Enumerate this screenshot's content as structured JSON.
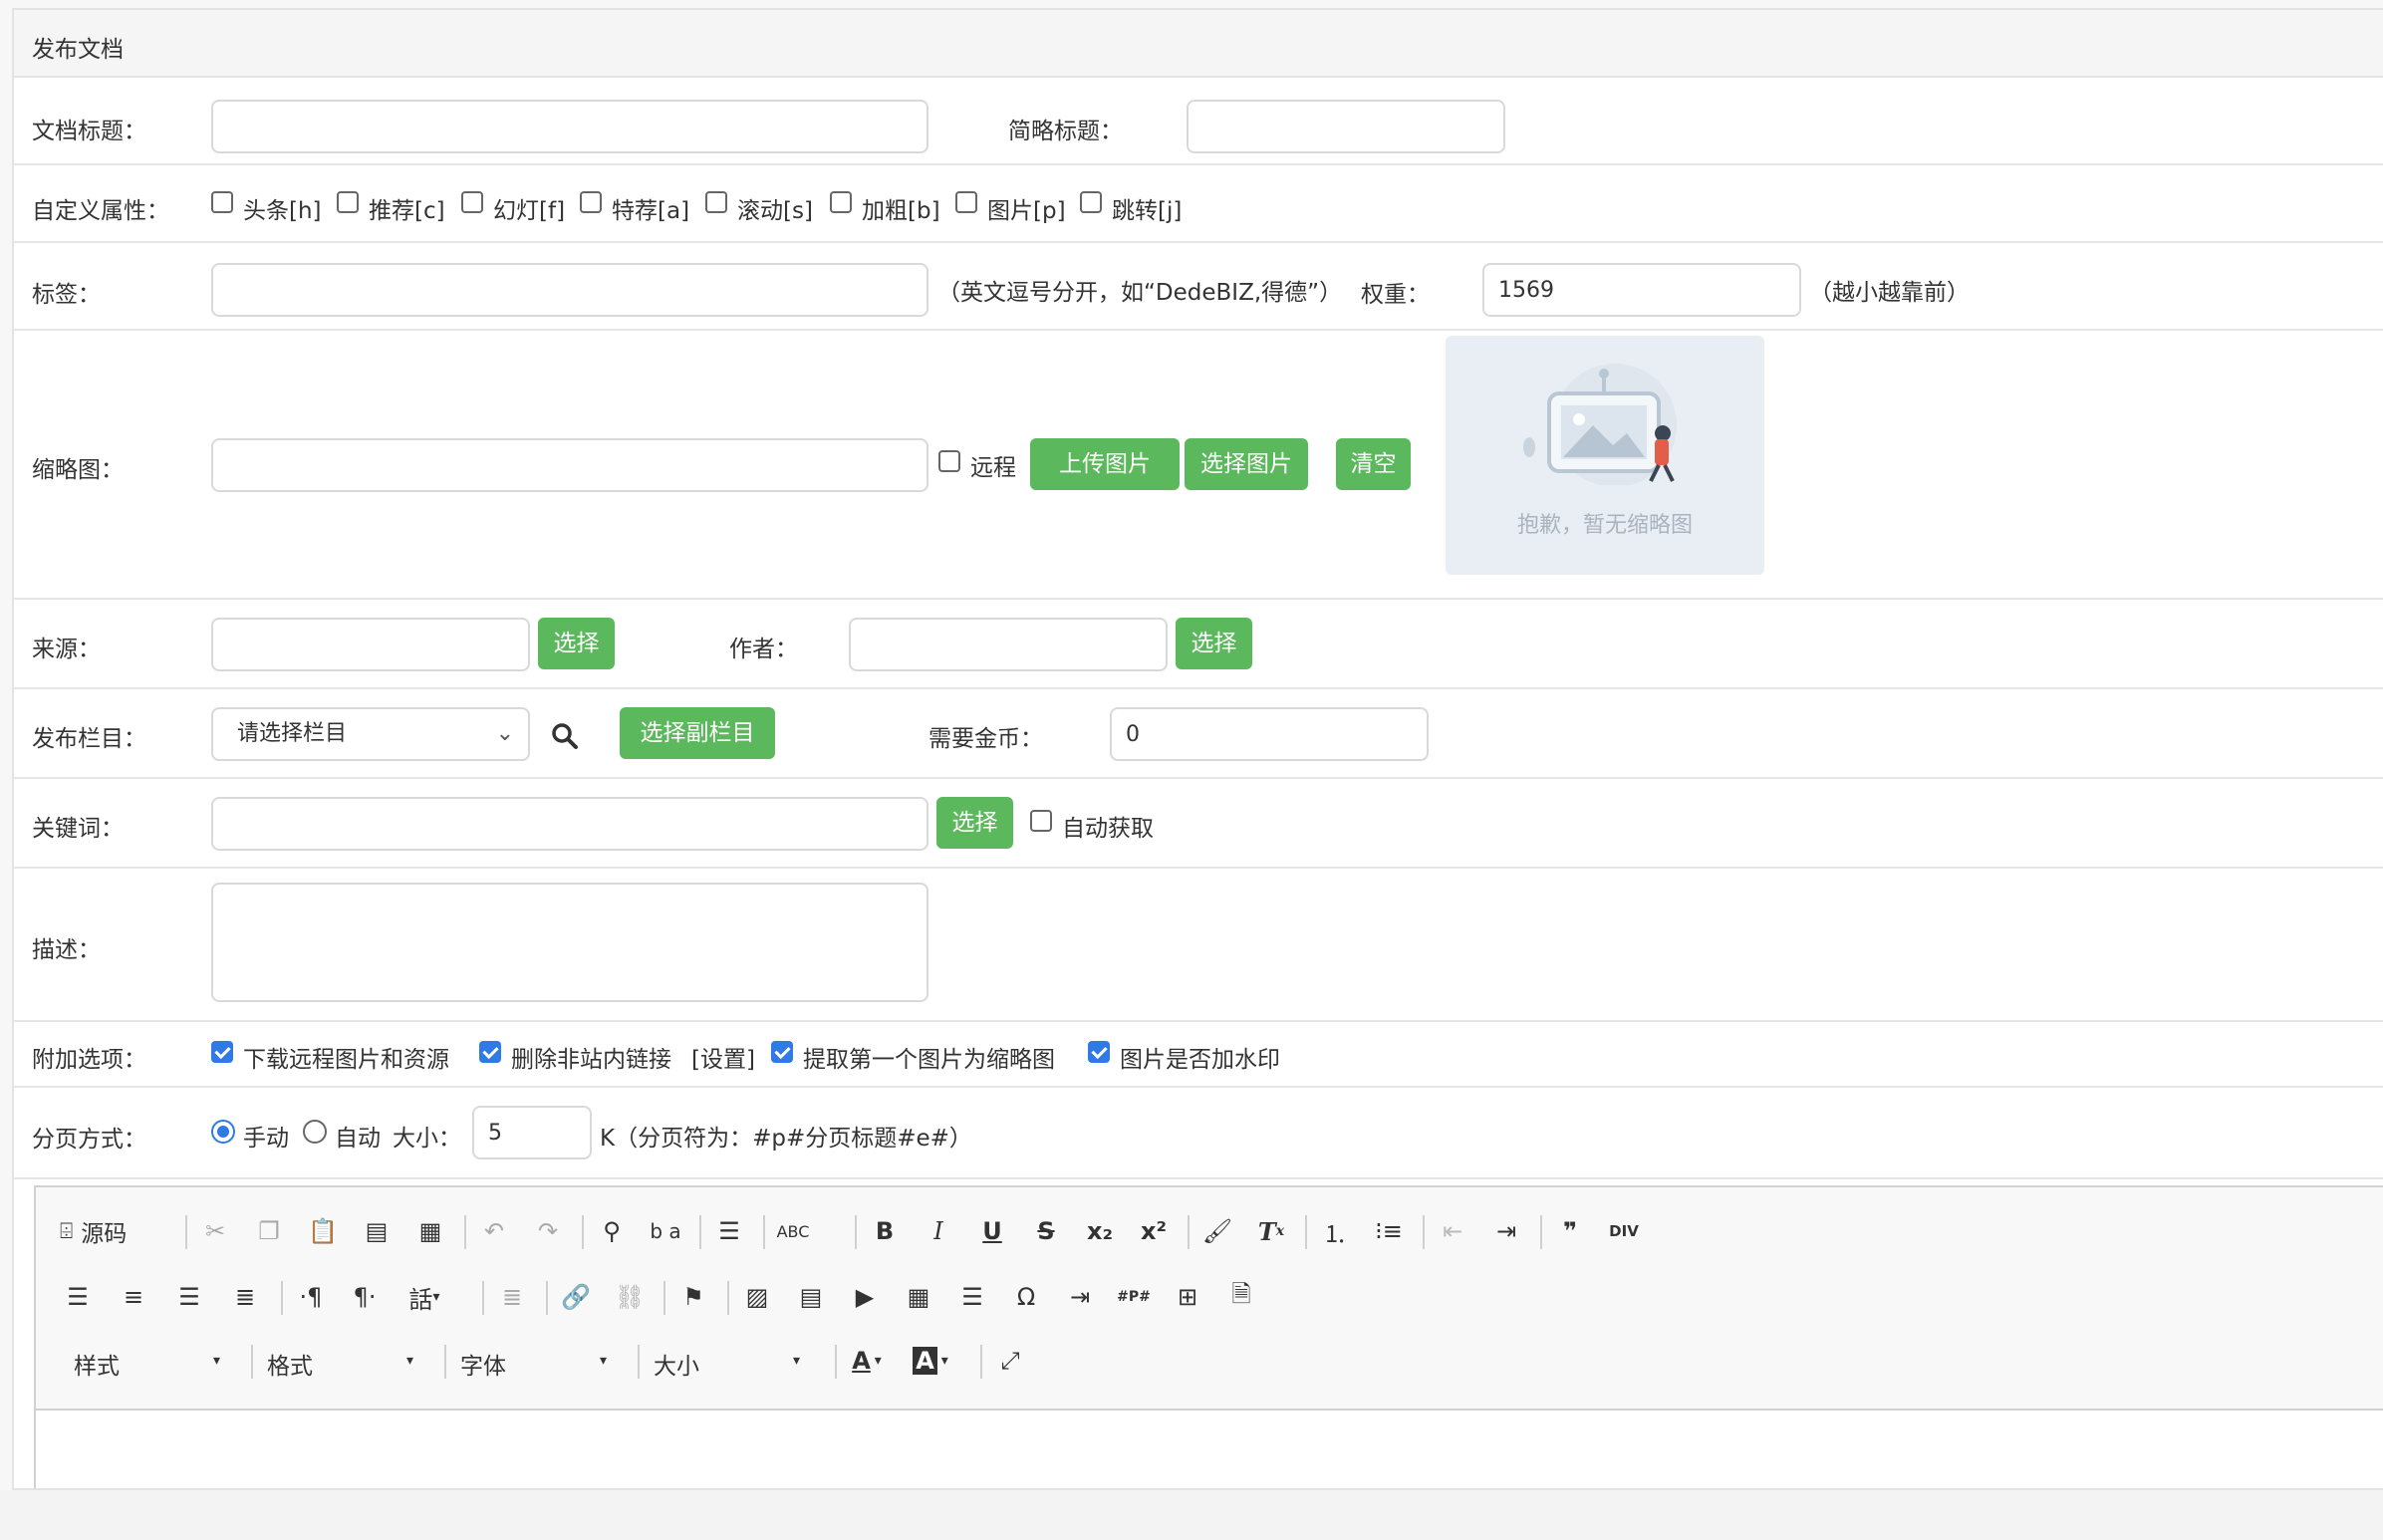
{
  "panel_title": "发布文档",
  "title_row": {
    "label": "文档标题：",
    "short_label": "简略标题："
  },
  "flags": {
    "label": "自定义属性：",
    "items": [
      "头条[h]",
      "推荐[c]",
      "幻灯[f]",
      "特荐[a]",
      "滚动[s]",
      "加粗[b]",
      "图片[p]",
      "跳转[j]"
    ]
  },
  "tags": {
    "label": "标签：",
    "hint": "（英文逗号分开，如“DedeBIZ,得德”）",
    "weight_label": "权重：",
    "weight_value": "1569",
    "weight_hint": "（越小越靠前）"
  },
  "thumbnail": {
    "label": "缩略图：",
    "remote_label": "远程",
    "upload_btn": "上传图片",
    "choose_btn": "选择图片",
    "clear_btn": "清空",
    "placeholder_text": "抱歉，暂无缩略图"
  },
  "source": {
    "label": "来源：",
    "btn": "选择",
    "author_label": "作者：",
    "author_btn": "选择"
  },
  "category": {
    "label": "发布栏目：",
    "selected": "请选择栏目",
    "sub_btn": "选择副栏目",
    "coin_label": "需要金币：",
    "coin_value": "0"
  },
  "keywords": {
    "label": "关键词：",
    "btn": "选择",
    "auto_label": "自动获取"
  },
  "description": {
    "label": "描述："
  },
  "extra": {
    "label": "附加选项：",
    "opt1": "下载远程图片和资源",
    "opt2": "删除非站内链接",
    "settings_link": "[设置]",
    "opt3": "提取第一个图片为缩略图",
    "opt4": "图片是否加水印"
  },
  "paging": {
    "label": "分页方式：",
    "manual": "手动",
    "auto": "自动",
    "size_label": "大小：",
    "size_value": "5",
    "hint": "K（分页符为：#p#分页标题#e#）"
  },
  "editor": {
    "source_label": "源码",
    "row1_icons": [
      "cut-icon",
      "copy-icon",
      "paste-icon",
      "paste-text-icon",
      "paste-word-icon",
      "undo-icon",
      "redo-icon",
      "find-icon",
      "replace-icon",
      "select-all-icon",
      "spellcheck-icon",
      "bold-icon",
      "italic-icon",
      "underline-icon",
      "strike-icon",
      "subscript-icon",
      "superscript-icon",
      "copy-format-icon",
      "remove-format-icon",
      "numbered-list-icon",
      "bulleted-list-icon",
      "outdent-icon",
      "indent-icon",
      "blockquote-icon",
      "div-icon"
    ],
    "row1_glyphs": {
      "bold": "B",
      "italic": "I",
      "underline": "U",
      "strike": "S",
      "sub": "x₂",
      "sup": "x²",
      "abc": "ABC",
      "quote": "❞",
      "div": "DIV",
      "ba": "b a"
    },
    "row2_glyphs": {
      "omega": "Ω",
      "lang": "話",
      "ltr": "·¶",
      "rtl": "¶·",
      "pb": "#P#"
    },
    "dropdowns": [
      "样式",
      "格式",
      "字体",
      "大小"
    ],
    "colors": {
      "text": "A",
      "bg": "A"
    }
  },
  "colors": {
    "accent": "#5cb85c",
    "checkbox": "#2f7ae5"
  }
}
